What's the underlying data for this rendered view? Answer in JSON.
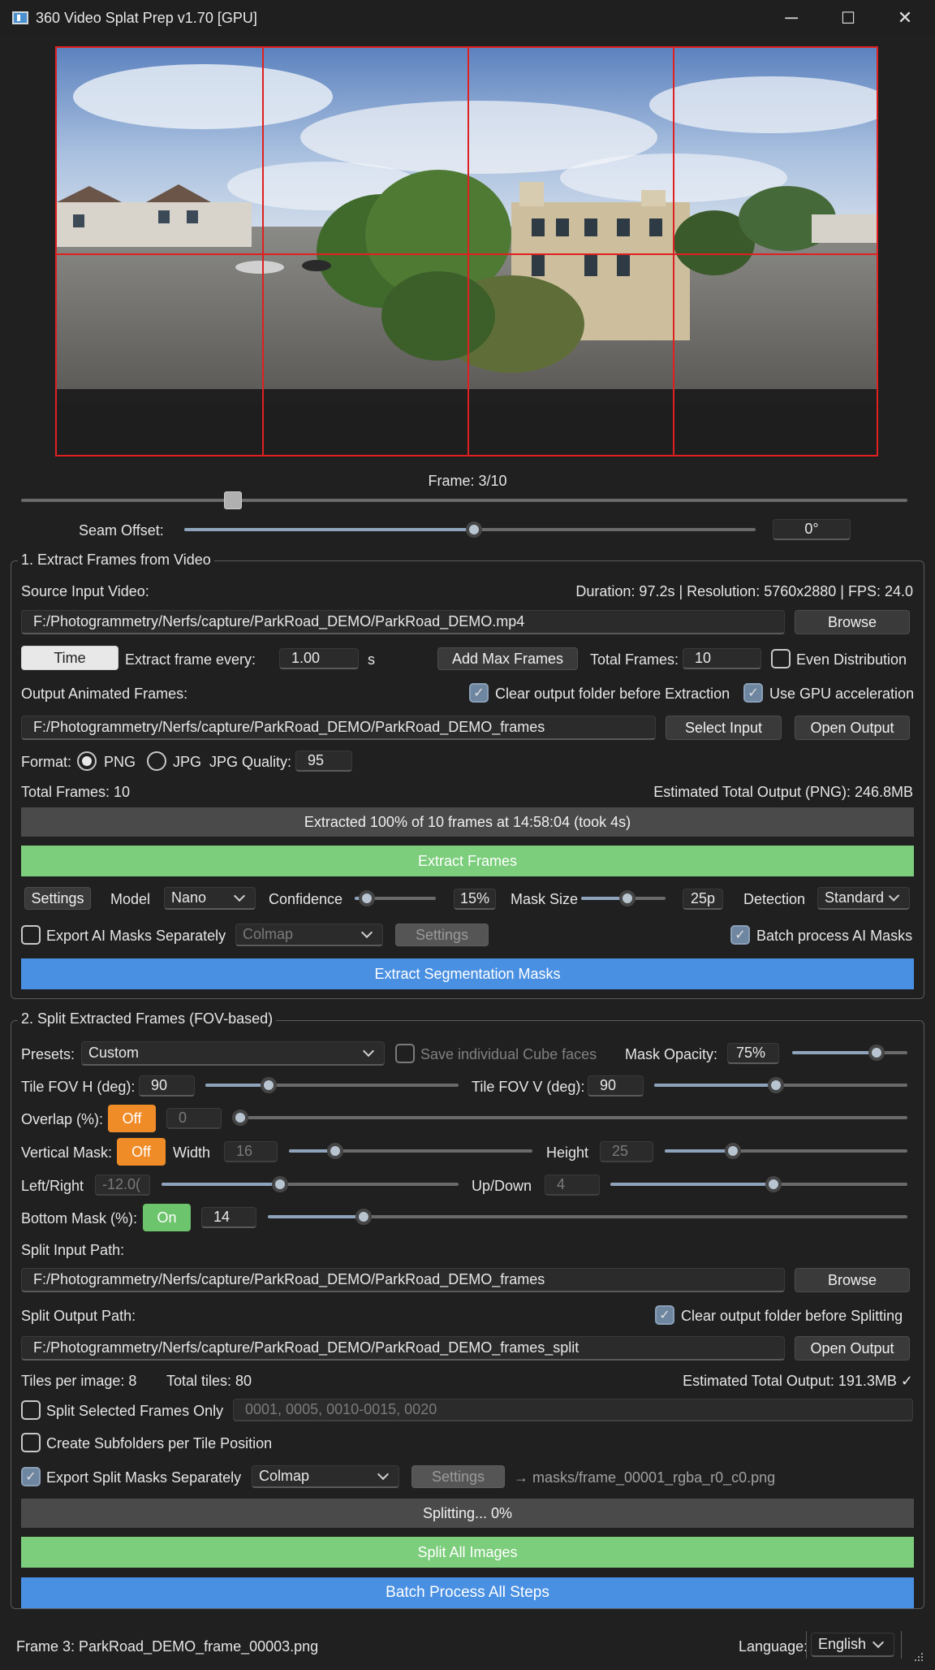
{
  "window": {
    "title": "360 Video Splat Prep v1.70 [GPU]",
    "minimize": "─",
    "maximize": "☐",
    "close": "✕"
  },
  "preview": {
    "frame_label": "Frame: 3/10",
    "frame_slider": 0.23,
    "seam_label": "Seam Offset:",
    "seam_value": "0°",
    "seam_slider": 0.5
  },
  "section1": {
    "title": "1. Extract Frames from Video",
    "source_label": "Source Input Video:",
    "video_info": "Duration: 97.2s | Resolution: 5760x2880 | FPS: 24.0",
    "source_path": "F:/Photogrammetry/Nerfs/capture/ParkRoad_DEMO/ParkRoad_DEMO.mp4",
    "browse": "Browse",
    "time_btn": "Time",
    "every_label": "Extract frame every:",
    "every_value": "1.00",
    "every_unit": "s",
    "add_max": "Add Max Frames",
    "total_label": "Total Frames:",
    "total_value": "10",
    "even_dist": "Even Distribution",
    "output_label": "Output Animated Frames:",
    "clear_output": "Clear output folder before Extraction",
    "use_gpu": "Use GPU acceleration",
    "output_path": "F:/Photogrammetry/Nerfs/capture/ParkRoad_DEMO/ParkRoad_DEMO_frames",
    "select_input": "Select Input",
    "open_output": "Open Output",
    "format_label": "Format:",
    "png": "PNG",
    "jpg": "JPG",
    "jpg_quality_label": "JPG Quality:",
    "jpg_quality": "95",
    "total_frames_text": "Total Frames: 10",
    "estimated": "Estimated Total Output (PNG): 246.8MB",
    "progress_text": "Extracted 100% of 10 frames at 14:58:04 (took 4s)",
    "progress": 1.0,
    "extract_btn": "Extract Frames",
    "settings": "Settings",
    "model_label": "Model",
    "model_value": "Nano",
    "confidence_label": "Confidence",
    "confidence_value": "15%",
    "confidence_slider": 0.15,
    "mask_size_label": "Mask Size",
    "mask_size_value": "25p",
    "mask_size_slider": 0.55,
    "detection_label": "Detection",
    "detection_value": "Standard",
    "export_ai": "Export AI Masks Separately",
    "ai_format": "Colmap",
    "ai_settings": "Settings",
    "batch_ai": "Batch process AI Masks",
    "seg_btn": "Extract Segmentation Masks"
  },
  "section2": {
    "title": "2. Split Extracted Frames (FOV-based)",
    "presets_label": "Presets:",
    "presets_value": "Custom",
    "save_cube": "Save individual Cube faces",
    "mask_opacity_label": "Mask Opacity:",
    "mask_opacity_value": "75%",
    "mask_opacity_slider": 0.75,
    "fov_h_label": "Tile FOV H (deg):",
    "fov_h_value": "90",
    "fov_h_slider": 0.25,
    "fov_v_label": "Tile FOV V (deg):",
    "fov_v_value": "90",
    "fov_v_slider": 0.48,
    "overlap_label": "Overlap (%):",
    "overlap_toggle": "Off",
    "overlap_value": "0",
    "overlap_slider": 0.0,
    "vmask_label": "Vertical Mask:",
    "vmask_toggle": "Off",
    "width_label": "Width",
    "width_value": "16",
    "width_slider": 0.19,
    "height_label": "Height",
    "height_value": "25",
    "height_slider": 0.28,
    "lr_label": "Left/Right",
    "lr_value": "-12.0(",
    "lr_slider": 0.4,
    "ud_label": "Up/Down",
    "ud_value": "4",
    "ud_slider": 0.55,
    "bottom_label": "Bottom Mask (%):",
    "bottom_toggle": "On",
    "bottom_value": "14",
    "bottom_slider": 0.15,
    "split_input_label": "Split Input Path:",
    "split_input_path": "F:/Photogrammetry/Nerfs/capture/ParkRoad_DEMO/ParkRoad_DEMO_frames",
    "browse": "Browse",
    "split_output_label": "Split Output Path:",
    "clear_split": "Clear output folder before Splitting",
    "split_output_path": "F:/Photogrammetry/Nerfs/capture/ParkRoad_DEMO/ParkRoad_DEMO_frames_split",
    "open_output": "Open Output",
    "tiles_per_image": "Tiles per image: 8",
    "total_tiles": "Total tiles: 80",
    "estimated": "Estimated Total Output: 191.3MB ✓",
    "split_selected": "Split Selected Frames Only",
    "selected_placeholder": "0001, 0005, 0010-0015, 0020",
    "subfolders": "Create Subfolders per Tile Position",
    "export_split": "Export Split Masks Separately",
    "split_format": "Colmap",
    "split_settings": "Settings",
    "mask_path_hint": "→ masks/frame_00001_rgba_r0_c0.png",
    "progress_text": "Splitting... 0%",
    "split_btn": "Split All Images",
    "batch_btn": "Batch Process All Steps"
  },
  "status": {
    "frame_text": "Frame 3: ParkRoad_DEMO_frame_00003.png",
    "language_label": "Language:",
    "language_value": "English"
  },
  "colors": {
    "accent_green": "#7ccd7c",
    "accent_blue": "#4a90e2",
    "toggle_orange": "#f08c28",
    "grid_red": "#e02020"
  }
}
